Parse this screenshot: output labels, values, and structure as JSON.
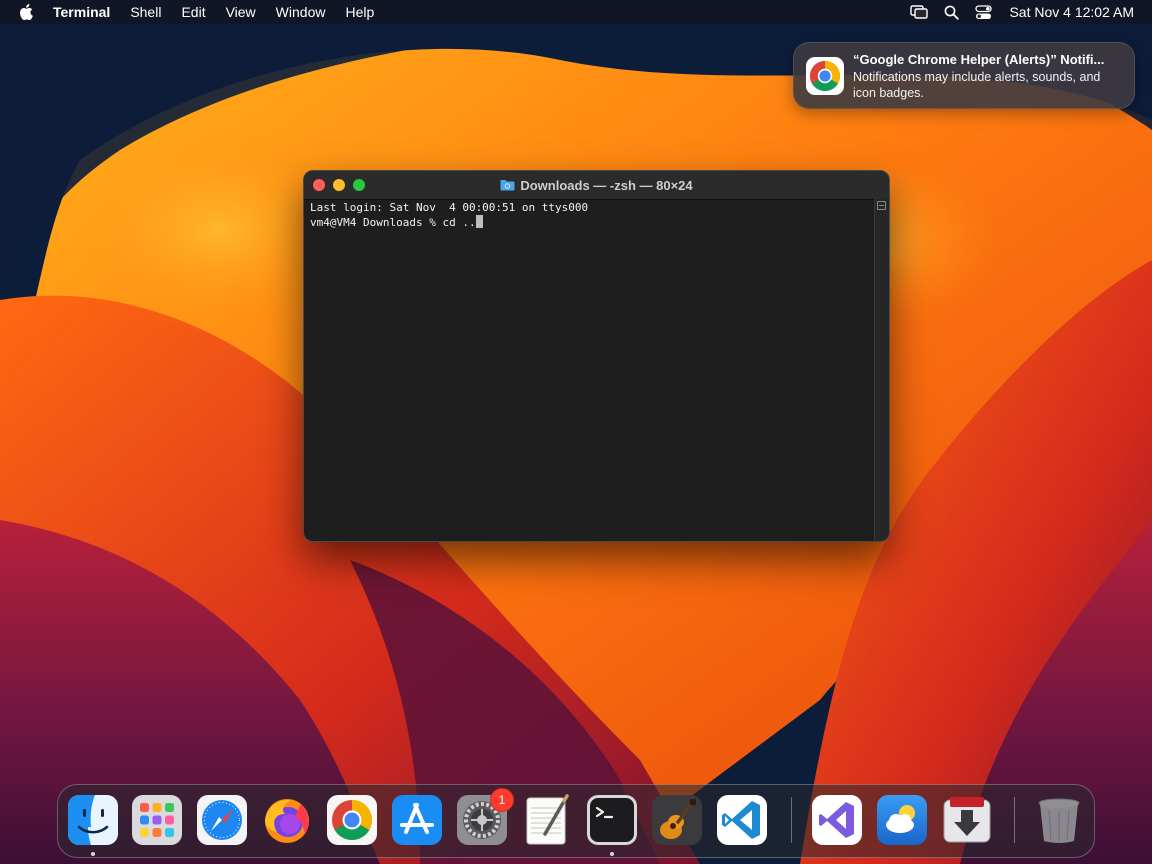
{
  "menubar": {
    "app_name": "Terminal",
    "menus": [
      "Shell",
      "Edit",
      "View",
      "Window",
      "Help"
    ],
    "clock": "Sat Nov 4  12:02 AM",
    "icons": [
      "apple-logo-icon",
      "screen-mirroring-icon",
      "spotlight-search-icon",
      "control-center-icon"
    ]
  },
  "notification": {
    "app_icon": "chrome-icon",
    "title": "“Google Chrome Helper (Alerts)” Notifi...",
    "body": "Notifications may include alerts, sounds, and icon badges."
  },
  "terminal": {
    "title": "Downloads — -zsh — 80×24",
    "title_icon": "folder-icon",
    "lines": [
      "Last login: Sat Nov  4 00:00:51 on ttys000",
      "vm4@VM4 Downloads % cd .."
    ]
  },
  "dock": {
    "items": [
      {
        "name": "Finder",
        "icon": "finder-icon",
        "running": true
      },
      {
        "name": "Launchpad",
        "icon": "launchpad-icon",
        "running": false
      },
      {
        "name": "Safari",
        "icon": "safari-icon",
        "running": false
      },
      {
        "name": "Firefox",
        "icon": "firefox-icon",
        "running": false
      },
      {
        "name": "Google Chrome",
        "icon": "chrome-icon",
        "running": false
      },
      {
        "name": "App Store",
        "icon": "app-store-icon",
        "running": false
      },
      {
        "name": "System Settings",
        "icon": "system-settings-icon",
        "running": false,
        "badge": "1"
      },
      {
        "name": "TextEdit",
        "icon": "textedit-icon",
        "running": false
      },
      {
        "name": "Terminal",
        "icon": "terminal-icon",
        "running": true
      },
      {
        "name": "GarageBand",
        "icon": "garageband-icon",
        "running": false
      },
      {
        "name": "Visual Studio Code",
        "icon": "vscode-icon",
        "running": false
      },
      {
        "name": "Visual Studio",
        "icon": "visual-studio-icon",
        "running": false
      },
      {
        "name": "Weather",
        "icon": "weather-icon",
        "running": false
      },
      {
        "name": "Transmit",
        "icon": "download-app-icon",
        "running": false
      },
      {
        "name": "Trash",
        "icon": "trash-icon",
        "running": false
      }
    ]
  },
  "colors": {
    "terminal_bg": "#1e1e1e",
    "notification_bg": "#3e3a40",
    "badge": "#ff3b30"
  }
}
